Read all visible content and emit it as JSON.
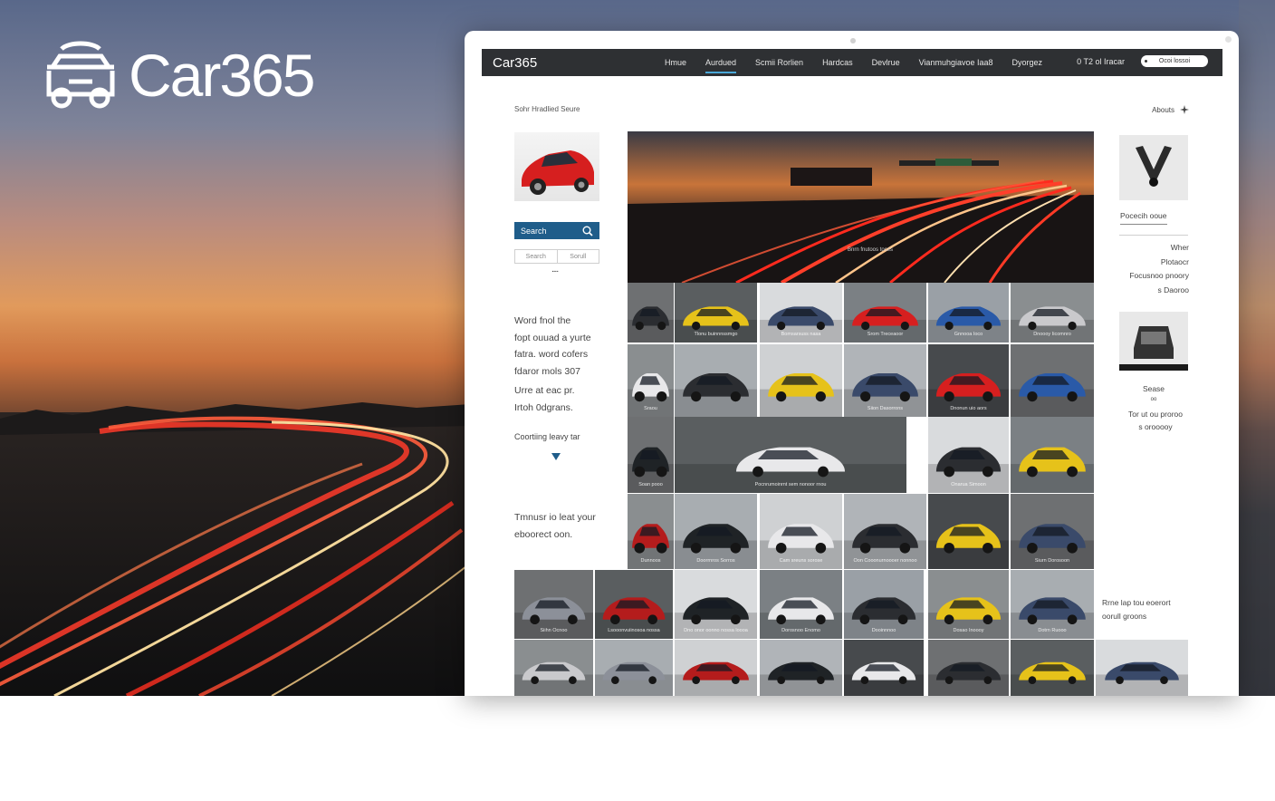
{
  "brand": {
    "name": "Car365",
    "color": "#ffffff"
  },
  "navbar": {
    "logo": "Car365",
    "items": [
      "Hmue",
      "Aurdued",
      "Scmii Rorlien",
      "Hardcas",
      "Devlrue",
      "Vianmuhgiavoe Iaa8",
      "Dyorgez"
    ],
    "active_index": 1,
    "phone": "0 T2 ol Iracar",
    "pill": "Ocoi lossoi"
  },
  "header": {
    "section_title": "Sohr Hradlied Seure",
    "about": "Abouts"
  },
  "sidebar": {
    "search_label": "Search",
    "tabs": [
      "Search",
      "Sorull"
    ],
    "dots": "....",
    "blurb1": [
      "Word fnol the",
      "fopt ouuad a yurte",
      "fatra. word cofers",
      "fdaror mols 307"
    ],
    "blurb2": [
      "Urre at eac pr.",
      "Irtoh 0dgrans."
    ],
    "blurb3": "Coortiing leavy tar",
    "blurb4": [
      "Tmnusr io leat your",
      "eboorect oon."
    ]
  },
  "hero_image": {
    "caption": "Bnrn fnutoos toces"
  },
  "grid": {
    "row1": [
      "",
      "Tlonu buinnnssmgo",
      "Bomsarsuss nasa",
      "Srom Treceaoor",
      "Gnnooa Ioco",
      "Dnoooy Iicomnro"
    ],
    "row2": [
      "Sraou",
      "",
      "",
      "Siion Dasorrons",
      "Dnonun uio aors",
      ""
    ],
    "row3": [
      "Soan pooo",
      "Pocnrumoinrnt sem nonoor rnou",
      "Onarua Simoon",
      ""
    ],
    "row4": [
      "Dunnoos",
      "Doorrnros Sorros",
      "Cam sreuns sorose",
      "Oon Cooonurnoooer nonnoo",
      "",
      "Siurn Dorosoon"
    ],
    "row5": [
      "Siihn Ocnoo",
      "Lsooonvuiinosoa nossa",
      "Dno onor oonno nossa loooa",
      "Dorosnoo Enomo",
      "Dooinnnoo",
      "Dosao Inoooy",
      "Dotrn Ruooo"
    ]
  },
  "right_sidebar": {
    "link": "Pocecih ooue",
    "text1": [
      "Wher",
      "Plotaocr",
      "Focusnoo pnoory",
      "s Daoroo"
    ],
    "label": "Sease",
    "sublabel": "oo",
    "text2": [
      "Tor ut ou proroo",
      "s orooooy"
    ],
    "text3": [
      "Rrne lap tou eoerort",
      "oorull groons"
    ]
  },
  "colors": {
    "navbar_bg": "#2e3033",
    "search_button": "#1f5d8a",
    "accent": "#4aa8d8"
  }
}
